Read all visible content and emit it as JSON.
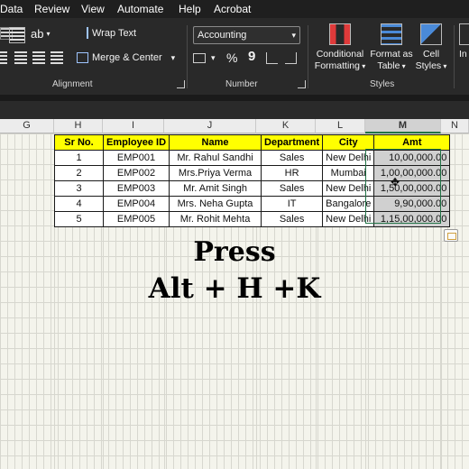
{
  "menu": [
    "Data",
    "Review",
    "View",
    "Automate",
    "Help",
    "Acrobat"
  ],
  "ribbon": {
    "alignment": {
      "wrap_text": "Wrap Text",
      "merge_center": "Merge & Center",
      "group_label": "Alignment"
    },
    "number": {
      "format_value": "Accounting",
      "percent": "%",
      "comma": "9",
      "group_label": "Number"
    },
    "styles": {
      "conditional_line1": "Conditional",
      "conditional_line2": "Formatting",
      "format_table_line1": "Format as",
      "format_table_line2": "Table",
      "cell_styles_line1": "Cell",
      "cell_styles_line2": "Styles",
      "group_label": "Styles"
    },
    "partial_label": "In"
  },
  "columns": [
    "G",
    "H",
    "I",
    "J",
    "K",
    "L",
    "M",
    "N"
  ],
  "selected_column": "M",
  "table": {
    "headers": [
      "Sr No.",
      "Employee ID",
      "Name",
      "Department",
      "City",
      "Amt"
    ],
    "rows": [
      [
        "1",
        "EMP001",
        "Mr. Rahul Sandhi",
        "Sales",
        "New Delhi",
        "10,00,000.00"
      ],
      [
        "2",
        "EMP002",
        "Mrs.Priya Verma",
        "HR",
        "Mumbai",
        "1,00,00,000.00"
      ],
      [
        "3",
        "EMP003",
        "Mr. Amit Singh",
        "Sales",
        "New Delhi",
        "1,50,00,000.00"
      ],
      [
        "4",
        "EMP004",
        "Mrs. Neha Gupta",
        "IT",
        "Bangalore",
        "9,90,000.00"
      ],
      [
        "5",
        "EMP005",
        "Mr. Rohit Mehta",
        "Sales",
        "New Delhi",
        "1,15,00,000.00"
      ]
    ]
  },
  "caption": {
    "line1": "Press",
    "line2": "Alt + H +K"
  },
  "colors": {
    "accent": "#217346",
    "header_fill": "#ffff00",
    "ribbon_bg": "#292929"
  }
}
